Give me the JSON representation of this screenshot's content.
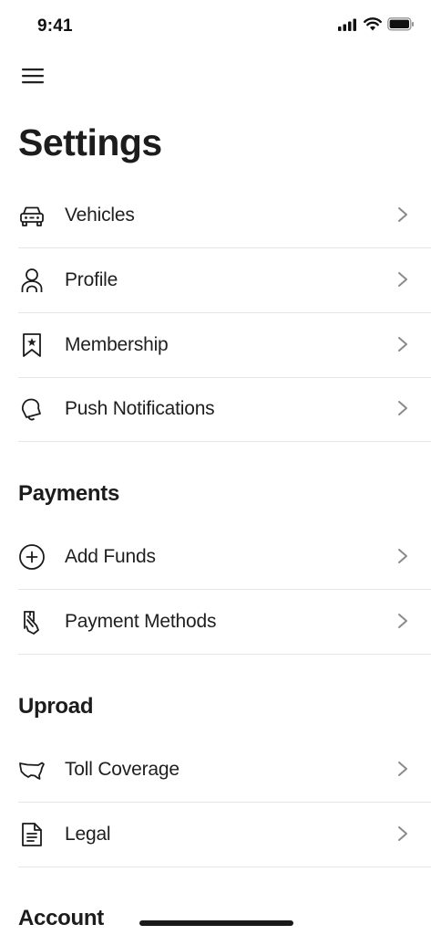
{
  "status_bar": {
    "time": "9:41"
  },
  "header": {
    "title": "Settings"
  },
  "general": {
    "items": [
      {
        "label": "Vehicles",
        "icon": "car-icon"
      },
      {
        "label": "Profile",
        "icon": "person-icon"
      },
      {
        "label": "Membership",
        "icon": "bookmark-star-icon"
      },
      {
        "label": "Push Notifications",
        "icon": "bell-icon"
      }
    ]
  },
  "payments": {
    "title": "Payments",
    "items": [
      {
        "label": "Add Funds",
        "icon": "plus-circle-icon"
      },
      {
        "label": "Payment Methods",
        "icon": "card-hand-icon"
      }
    ]
  },
  "uproad": {
    "title": "Uproad",
    "items": [
      {
        "label": "Toll Coverage",
        "icon": "usa-map-icon"
      },
      {
        "label": "Legal",
        "icon": "document-icon"
      }
    ]
  },
  "account": {
    "title": "Account"
  },
  "colors": {
    "text": "#1c1c1c",
    "divider": "#e6e6e6",
    "chevron": "#8a8a8a"
  }
}
